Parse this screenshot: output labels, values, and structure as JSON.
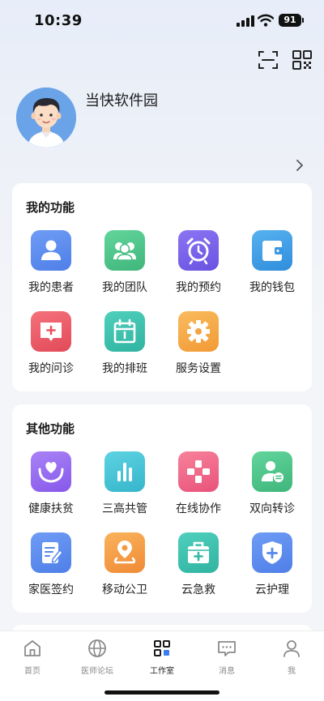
{
  "status_bar": {
    "time": "10:39",
    "battery": "91"
  },
  "profile": {
    "name": "当快软件园"
  },
  "my_functions": {
    "title": "我的功能",
    "items": [
      {
        "label": "我的患者",
        "icon": "patient-icon",
        "color": "#5b8cf0"
      },
      {
        "label": "我的团队",
        "icon": "team-icon",
        "color": "#4fc48c"
      },
      {
        "label": "我的预约",
        "icon": "alarm-clock-icon",
        "color": "#7a62ea"
      },
      {
        "label": "我的钱包",
        "icon": "wallet-icon",
        "color": "#3f9ee6"
      },
      {
        "label": "我的问诊",
        "icon": "consult-icon",
        "color": "#ec5f6a"
      },
      {
        "label": "我的排班",
        "icon": "calendar-icon",
        "color": "#3ec3b0"
      },
      {
        "label": "服务设置",
        "icon": "gear-icon",
        "color": "#f6a84a"
      }
    ]
  },
  "other_functions": {
    "title": "其他功能",
    "items": [
      {
        "label": "健康扶贫",
        "icon": "heart-hands-icon",
        "color": "#9a6ff2"
      },
      {
        "label": "三高共管",
        "icon": "bar-chart-icon",
        "color": "#45c6d8"
      },
      {
        "label": "在线协作",
        "icon": "collaboration-icon",
        "color": "#f26b89"
      },
      {
        "label": "双向转诊",
        "icon": "referral-icon",
        "color": "#4fc48c"
      },
      {
        "label": "家医签约",
        "icon": "contract-icon",
        "color": "#5b8cf0"
      },
      {
        "label": "移动公卫",
        "icon": "location-pin-icon",
        "color": "#f6a04a"
      },
      {
        "label": "云急救",
        "icon": "first-aid-kit-icon",
        "color": "#3ec3b0"
      },
      {
        "label": "云护理",
        "icon": "shield-plus-icon",
        "color": "#5b8cf0"
      }
    ]
  },
  "tabbar": [
    {
      "label": "首页",
      "icon": "home-icon"
    },
    {
      "label": "医师论坛",
      "icon": "globe-icon"
    },
    {
      "label": "工作室",
      "icon": "workspace-icon",
      "active": true
    },
    {
      "label": "消息",
      "icon": "message-icon"
    },
    {
      "label": "我",
      "icon": "person-icon"
    }
  ]
}
